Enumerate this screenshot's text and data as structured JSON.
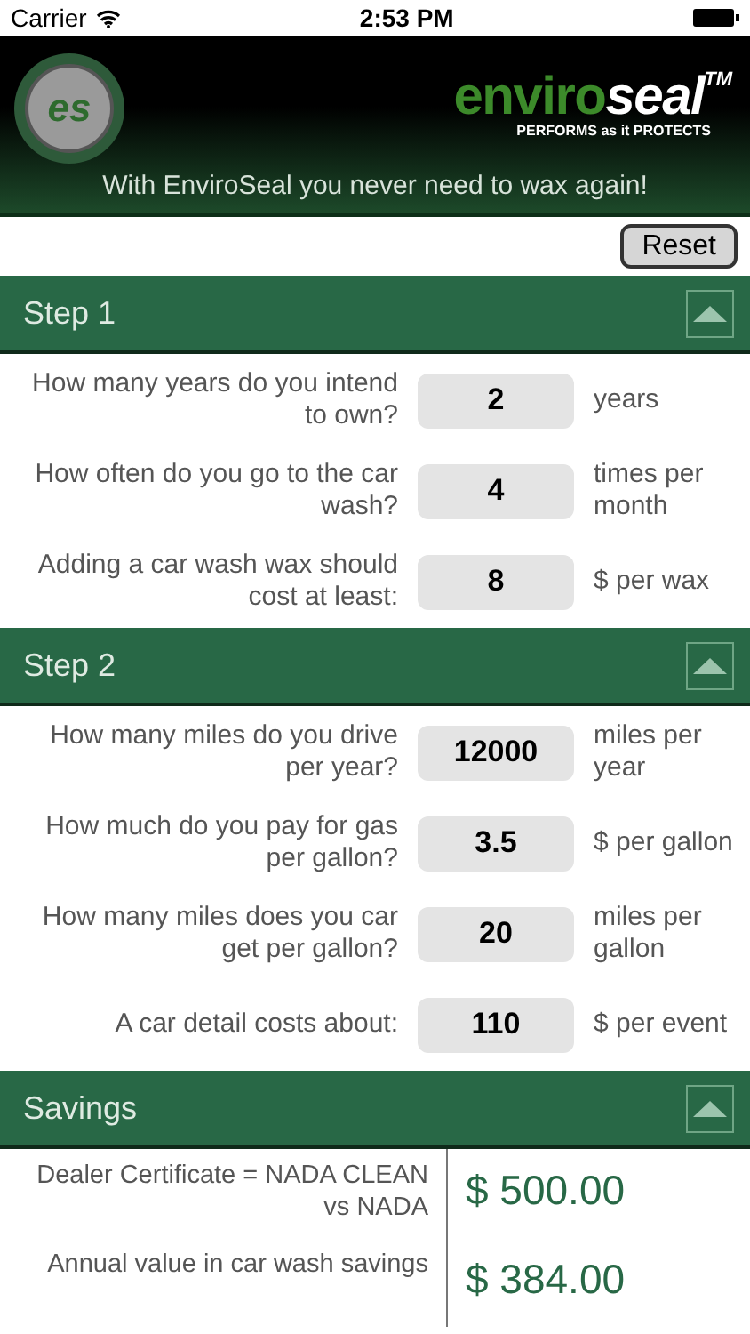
{
  "status_bar": {
    "carrier": "Carrier",
    "time": "2:53 PM"
  },
  "header": {
    "badge": "es",
    "brand_green": "enviro",
    "brand_white": "seal",
    "trademark": "TM",
    "tagline": "PERFORMS as it PROTECTS",
    "slogan": "With EnviroSeal you never need to wax again!"
  },
  "reset_button": "Reset",
  "sections": [
    {
      "title": "Step 1",
      "expanded": true,
      "kind": "inputs",
      "rows": [
        {
          "question": "How many years do you intend to own?",
          "value": "2",
          "unit": "years"
        },
        {
          "question": "How often do you go to the car wash?",
          "value": "4",
          "unit": "times per month"
        },
        {
          "question": "Adding a car wash wax should cost at least:",
          "value": "8",
          "unit": "$ per wax"
        }
      ]
    },
    {
      "title": "Step 2",
      "expanded": true,
      "kind": "inputs",
      "rows": [
        {
          "question": "How many miles do you drive per year?",
          "value": "12000",
          "unit": "miles per year"
        },
        {
          "question": "How much do you pay for gas per gallon?",
          "value": "3.5",
          "unit": "$ per gallon"
        },
        {
          "question": "How many miles does you car get per gallon?",
          "value": "20",
          "unit": "miles per gallon"
        },
        {
          "question": "A car detail costs about:",
          "value": "110",
          "unit": "$ per event"
        }
      ]
    },
    {
      "title": "Savings",
      "expanded": true,
      "kind": "results",
      "rows": [
        {
          "label": "Dealer Certificate = NADA CLEAN vs NADA",
          "amount": "$ 500.00"
        },
        {
          "label": "Annual value in car wash savings",
          "amount": "$ 384.00"
        }
      ]
    }
  ]
}
